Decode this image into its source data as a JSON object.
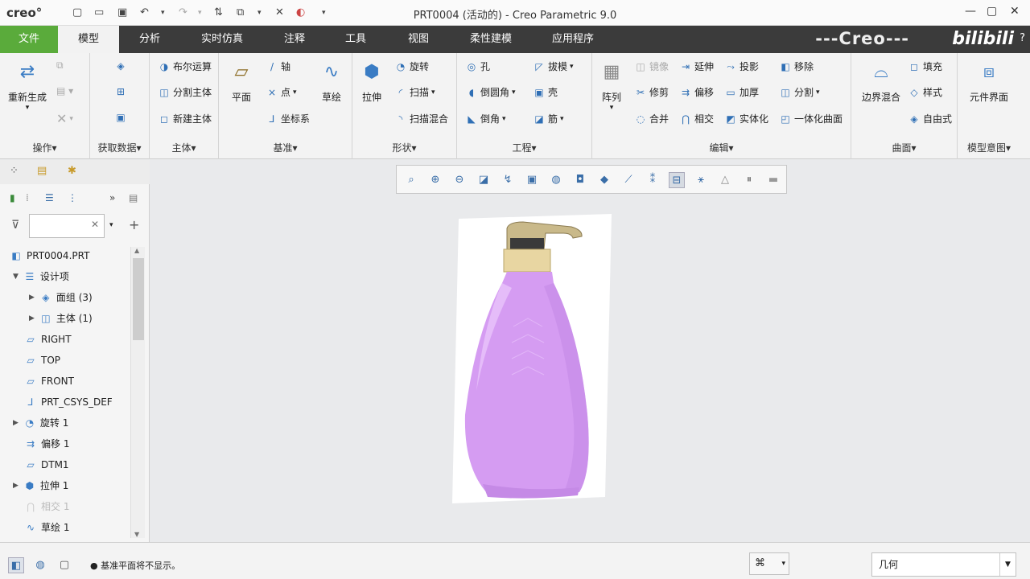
{
  "titlebar": {
    "app_logo": "creo°",
    "window_title": "PRT0004 (活动的) - Creo Parametric 9.0",
    "qa_icons": [
      "new-icon",
      "open-icon",
      "save-icon",
      "undo-icon",
      "redo-icon",
      "regenerate-icon",
      "windows-icon",
      "close-window-icon",
      "appearance-icon",
      "customize-icon"
    ]
  },
  "tabs": [
    {
      "label": "文件",
      "key": "file"
    },
    {
      "label": "模型",
      "key": "model"
    },
    {
      "label": "分析",
      "key": "analysis"
    },
    {
      "label": "实时仿真",
      "key": "live-sim"
    },
    {
      "label": "注释",
      "key": "annotate"
    },
    {
      "label": "工具",
      "key": "tools"
    },
    {
      "label": "视图",
      "key": "view"
    },
    {
      "label": "柔性建模",
      "key": "flexible"
    },
    {
      "label": "应用程序",
      "key": "apps"
    }
  ],
  "brand_text": "---Creo---",
  "watermark": "bilibili",
  "help": "?",
  "ribbon": {
    "groups": {
      "operations": "操作▾",
      "get_data": "获取数据▾",
      "body": "主体▾",
      "datum": "基准▾",
      "shapes": "形状▾",
      "engineering": "工程▾",
      "editing": "编辑▾",
      "surfaces": "曲面▾",
      "model_intent": "模型意图▾"
    },
    "buttons": {
      "regenerate": "重新生成",
      "boolean": "布尔运算",
      "split_body": "分割主体",
      "new_body": "新建主体",
      "plane": "平面",
      "axis": "轴",
      "point": "点",
      "csys": "坐标系",
      "sketch": "草绘",
      "extrude": "拉伸",
      "revolve": "旋转",
      "sweep": "扫描",
      "swept_blend": "扫描混合",
      "hole": "孔",
      "round": "倒圆角",
      "chamfer": "倒角",
      "draft": "拔模",
      "shell": "壳",
      "rib": "筋",
      "pattern": "阵列",
      "mirror": "镜像",
      "trim": "修剪",
      "merge": "合并",
      "extend": "延伸",
      "offset": "偏移",
      "intersect": "相交",
      "project": "投影",
      "thicken": "加厚",
      "solidify": "实体化",
      "remove": "移除",
      "split": "分割",
      "unify_surface": "一体化曲面",
      "boundary_blend": "边界混合",
      "fill": "填充",
      "style": "样式",
      "freestyle": "自由式",
      "component_interface": "元件界面"
    }
  },
  "left_panel": {
    "filter_placeholder": "",
    "tree": [
      {
        "label": "PRT0004.PRT",
        "icon": "part-icon",
        "expander": "",
        "dim": false
      },
      {
        "label": "设计项",
        "icon": "design-items-icon",
        "expander": "▼",
        "dim": false
      },
      {
        "label": "面组 (3)",
        "icon": "quilt-icon",
        "expander": "▶",
        "dim": false
      },
      {
        "label": "主体 (1)",
        "icon": "body-icon",
        "expander": "▶",
        "dim": false
      },
      {
        "label": "RIGHT",
        "icon": "datum-plane-icon",
        "expander": "",
        "dim": false
      },
      {
        "label": "TOP",
        "icon": "datum-plane-icon",
        "expander": "",
        "dim": false
      },
      {
        "label": "FRONT",
        "icon": "datum-plane-icon",
        "expander": "",
        "dim": false
      },
      {
        "label": "PRT_CSYS_DEF",
        "icon": "csys-icon",
        "expander": "",
        "dim": false
      },
      {
        "label": "旋转 1",
        "icon": "revolve-icon",
        "expander": "▶",
        "dim": false
      },
      {
        "label": "偏移 1",
        "icon": "offset-icon",
        "expander": "",
        "dim": false
      },
      {
        "label": "DTM1",
        "icon": "datum-plane-icon",
        "expander": "",
        "dim": false
      },
      {
        "label": "拉伸 1",
        "icon": "extrude-icon",
        "expander": "▶",
        "dim": false
      },
      {
        "label": "相交 1",
        "icon": "intersect-icon",
        "expander": "",
        "dim": true
      },
      {
        "label": "草绘 1",
        "icon": "sketch-icon",
        "expander": "",
        "dim": false
      }
    ]
  },
  "status": {
    "message": "● 基准平面将不显示。",
    "selection_filter": "几何"
  },
  "colors": {
    "file_tab": "#5aab3b",
    "tabbar": "#3b3b3b",
    "bottle_body": "#d59cf2",
    "pump_metal": "#c9b98a"
  }
}
